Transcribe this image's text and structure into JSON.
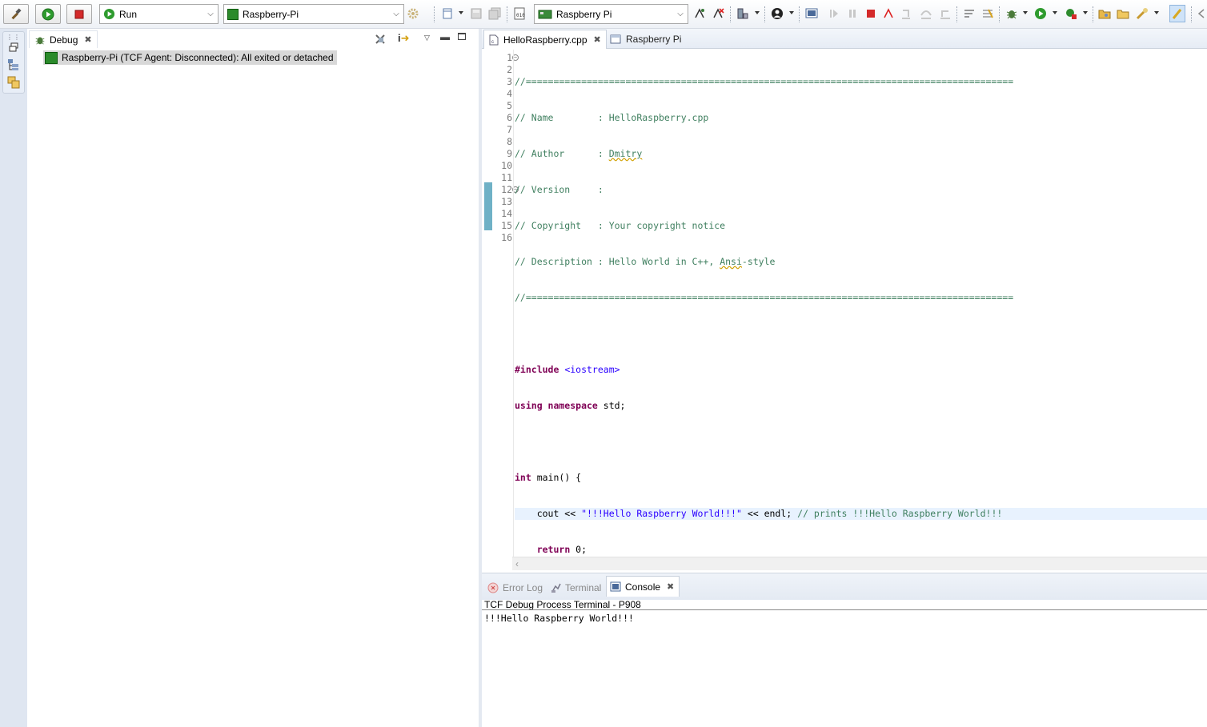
{
  "toolbar": {
    "run_mode": "Run",
    "launch_target": "Raspberry-Pi",
    "connection": "Raspberry Pi"
  },
  "debug_view": {
    "tab_label": "Debug",
    "tree_item": "Raspberry-Pi (TCF Agent: Disconnected): All exited or detached"
  },
  "editor": {
    "tabs": [
      {
        "label": "HelloRaspberry.cpp",
        "active": true
      },
      {
        "label": "Raspberry Pi",
        "active": false
      }
    ],
    "line_numbers": [
      "1",
      "2",
      "3",
      "4",
      "5",
      "6",
      "7",
      "8",
      "9",
      "10",
      "11",
      "12",
      "13",
      "14",
      "15",
      "16"
    ],
    "code": {
      "l1": "//========================================================================================",
      "l2": "// Name        : HelloRaspberry.cpp",
      "l3_a": "// Author      : ",
      "l3_b": "Dmitry",
      "l4": "// Version     :",
      "l5": "// Copyright   : Your copyright notice",
      "l6_a": "// Description : Hello World in C++, ",
      "l6_b": "Ansi",
      "l6_c": "-style",
      "l7": "//========================================================================================",
      "l8": "",
      "l9_kw": "#include",
      "l9_rest": " <iostream>",
      "l10_kw": "using namespace",
      "l10_rest": " std;",
      "l11": "",
      "l12_kw": "int",
      "l12_rest": " main() {",
      "l13_a": "    cout << ",
      "l13_str": "\"!!!Hello Raspberry World!!!\"",
      "l13_b": " << endl; ",
      "l13_cmt": "// prints !!!Hello Raspberry World!!!",
      "l14_kw": "return",
      "l14_indent": "    ",
      "l14_rest": " 0;",
      "l15": "}",
      "l16": ""
    }
  },
  "console_view": {
    "tabs": [
      {
        "label": "Error Log",
        "active": false
      },
      {
        "label": "Terminal",
        "active": false
      },
      {
        "label": "Console",
        "active": true
      }
    ],
    "process_title": "TCF Debug Process Terminal - P908",
    "output": "!!!Hello Raspberry World!!!"
  },
  "colors": {
    "comment": "#3f7f5f",
    "keyword": "#7f0055",
    "string": "#2a00ff",
    "current_line": "#e8f2fe"
  }
}
